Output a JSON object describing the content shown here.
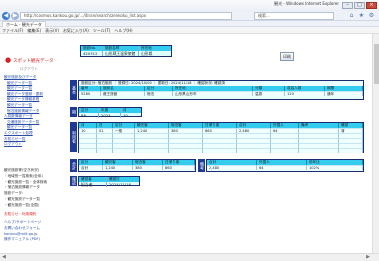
{
  "browser": {
    "url": "http://cosmos.kankou.go.jp/.../itiran/search/zenkoku_list.aspx",
    "search_placeholder": "検索...",
    "tab_title": "ホーム - 観光データ",
    "window_title": "観光 - Windows Internet Explorer",
    "menu": [
      "ファイル(F)",
      "編集(E)",
      "表示(V)",
      "お気に入り(A)",
      "ツール(T)",
      "ヘルプ(H)"
    ]
  },
  "sidebar": {
    "logo_text": "スポット観光データ",
    "logo_sub": "ログアウト",
    "links": [
      "観光施設及びデータ",
      "観光データ一覧",
      "観光データ一覧",
      "観光データ登録・更新",
      "観光データ情報参照",
      "観光データ一覧",
      "宿泊施設情報データ",
      "人員数情報データ",
      "交通施設データ一覧",
      "観光データ一覧",
      "エクスポート処理",
      "お知らせ一覧",
      "ログアウト"
    ],
    "group2": [
      "観光施設等(空き状況)",
      "・地域別一覧検索(全体)",
      "・観光施設一覧・全体検索",
      "・宿泊施設情報データ",
      "施設データ:",
      "・観光施設データ一覧",
      "・観光施設一覧(全国)"
    ],
    "group3_red": "お知らせ・利用規約",
    "group4": [
      "ヘルプ/サポートページ",
      "お問い合わせフォーム",
      "kankou@mlit.go.jp",
      "操作マニュアル (PDF)"
    ]
  },
  "main": {
    "header_row": {
      "head": [
        "施設No.",
        "施設名称",
        "所在地"
      ],
      "values": [
        "420312",
        "山形蔵王温泉旅館",
        "山形県"
      ]
    },
    "print_button": "印刷",
    "info_block": {
      "label": "基本",
      "head": "施設区分: 宿泊施設  ｜ 登録日: 2024/10/05  ｜ 更新日: 2024/11/18  ｜ 確認状況: 確認済",
      "row1_head": [
        "番号",
        "施設名",
        "区分",
        "所在地",
        "分類",
        "収容人数",
        "期間"
      ],
      "row1_values": [
        "5280",
        "蔵王旅館",
        "宿泊",
        "山形県山形市",
        "温泉",
        "120",
        "通年"
      ]
    },
    "small_block": {
      "head": [
        "区分",
        "年度",
        "月"
      ],
      "values": [
        "R6",
        "2024",
        "10"
      ]
    },
    "table_block": {
      "label": "利用者",
      "headers": [
        "月",
        "日",
        "区分",
        "観光客",
        "宿泊客",
        "日帰り客",
        "合計",
        "外国人",
        "備考",
        "確認"
      ],
      "rows": [
        [
          "10",
          "01",
          "一般",
          "1,240",
          "380",
          "860",
          "2,480",
          "64",
          "",
          "済"
        ],
        [
          "",
          "",
          "",
          "",
          "",
          "",
          "",
          "",
          "",
          ""
        ],
        [
          "",
          "",
          "",
          "",
          "",
          "",
          "",
          "",
          "",
          ""
        ],
        [
          "",
          "",
          "",
          "",
          "",
          "",
          "",
          "",
          "",
          ""
        ],
        [
          "",
          "",
          "",
          "",
          "",
          "",
          "",
          "",
          "",
          ""
        ]
      ]
    },
    "bottom_row": {
      "label": "合計",
      "head": [
        "区分",
        "観光客",
        "宿泊客",
        "日帰り客",
        "合計",
        "外国人",
        "前年比"
      ],
      "values": [
        "合計",
        "1,240",
        "380",
        "860",
        "2,480",
        "64",
        "102%"
      ],
      "extra_label": "備考"
    },
    "last_block": {
      "label": "確認",
      "head": [
        "確認者",
        "確認日"
      ],
      "values": [
        "担当者",
        "2024/11/18"
      ]
    }
  }
}
